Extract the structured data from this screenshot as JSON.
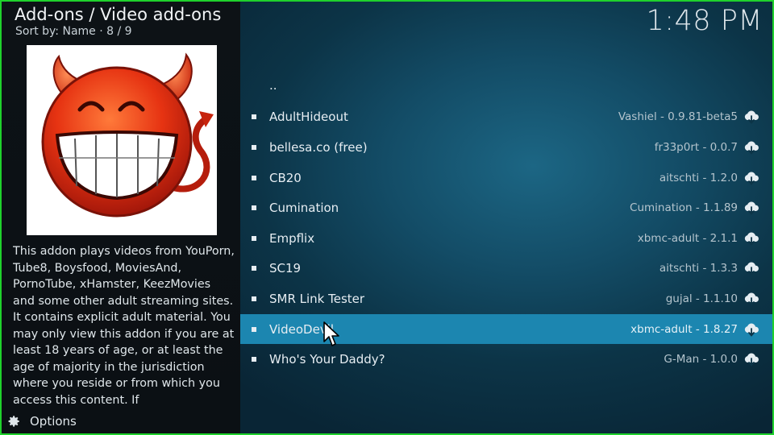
{
  "header": {
    "title": "Add-ons / Video add-ons",
    "sort": "Sort by: Name  ·  8 / 9"
  },
  "clock": "1:48 PM",
  "thumbnail": {
    "icon": "devil-smiley-icon"
  },
  "description": "This addon plays videos from YouPorn, Tube8, Boysfood, MoviesAnd, PornoTube, xHamster, KeezMovies and some other adult streaming sites. It contains explicit adult material. You may only view this addon if you are at least 18 years of age, or at least the age of majority in the jurisdiction where you reside or from which you access this content. If",
  "options_label": "Options",
  "list": {
    "parent": "..",
    "items": [
      {
        "name": "AdultHideout",
        "version": "Vashiel - 0.9.81-beta5",
        "selected": false
      },
      {
        "name": "bellesa.co (free)",
        "version": "fr33p0rt - 0.0.7",
        "selected": false
      },
      {
        "name": "CB20",
        "version": "aitschti - 1.2.0",
        "selected": false
      },
      {
        "name": "Cumination",
        "version": "Cumination - 1.1.89",
        "selected": false
      },
      {
        "name": "Empflix",
        "version": "xbmc-adult - 2.1.1",
        "selected": false
      },
      {
        "name": "SC19",
        "version": "aitschti - 1.3.3",
        "selected": false
      },
      {
        "name": "SMR Link Tester",
        "version": "gujal - 1.1.10",
        "selected": false
      },
      {
        "name": "VideoDevil",
        "version": "xbmc-adult - 1.8.27",
        "selected": true
      },
      {
        "name": "Who's Your Daddy?",
        "version": "G-Man - 1.0.0",
        "selected": false
      }
    ]
  },
  "colors": {
    "selection": "#1c86b0",
    "frame": "#1fd12c",
    "devil_red": "#e63312"
  }
}
